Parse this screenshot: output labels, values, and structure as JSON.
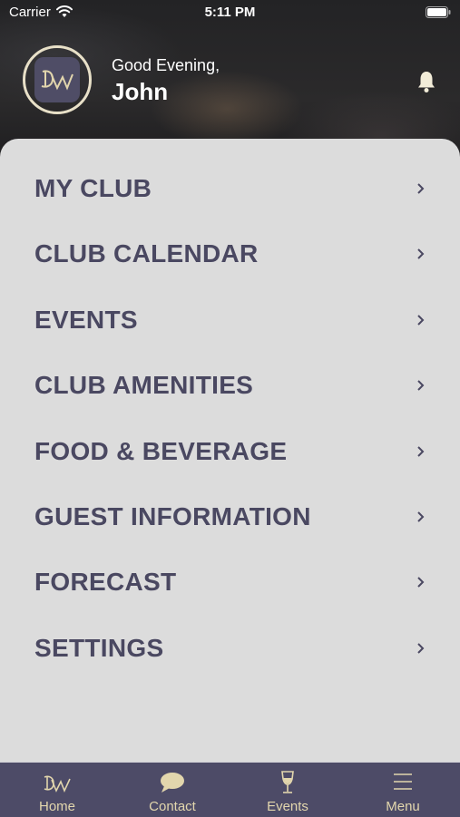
{
  "status_bar": {
    "carrier": "Carrier",
    "time": "5:11 PM"
  },
  "header": {
    "greeting": "Good Evening,",
    "username": "John",
    "logo_text": "DW",
    "accent_color": "#e2d6ad"
  },
  "menu": {
    "items": [
      {
        "label": "MY CLUB"
      },
      {
        "label": "CLUB CALENDAR"
      },
      {
        "label": "EVENTS"
      },
      {
        "label": "CLUB AMENITIES"
      },
      {
        "label": "FOOD & BEVERAGE"
      },
      {
        "label": "GUEST INFORMATION"
      },
      {
        "label": "FORECAST"
      },
      {
        "label": "SETTINGS"
      }
    ],
    "text_color": "#4a4861",
    "background": "#dcdcdc"
  },
  "tab_bar": {
    "background": "#4d4b67",
    "tabs": [
      {
        "label": "Home",
        "icon": "dw-logo-icon"
      },
      {
        "label": "Contact",
        "icon": "chat-bubble-icon"
      },
      {
        "label": "Events",
        "icon": "wine-glass-icon"
      },
      {
        "label": "Menu",
        "icon": "hamburger-icon"
      }
    ]
  }
}
